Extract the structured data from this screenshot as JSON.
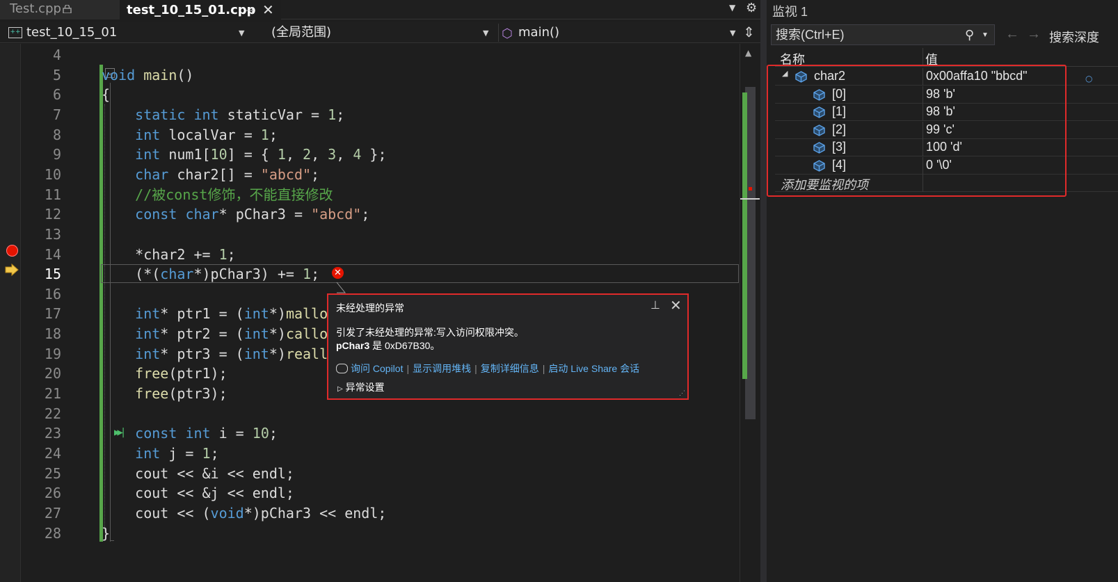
{
  "tabs": [
    {
      "label": "Test.cpp",
      "locked": true,
      "active": false
    },
    {
      "label": "test_10_15_01.cpp",
      "active": true
    }
  ],
  "navbar": {
    "project": "test_10_15_01",
    "scope": "(全局范围)",
    "function": "main()"
  },
  "code": {
    "current_line": 15,
    "breakpoint_line": 14,
    "lines": [
      {
        "n": "4",
        "html": ""
      },
      {
        "n": "5",
        "html": "<span class=\"kw\">void</span> <span class=\"fn\">main</span>()"
      },
      {
        "n": "6",
        "html": "{"
      },
      {
        "n": "7",
        "html": "    <span class=\"kw\">static</span> <span class=\"kw\">int</span> staticVar = <span class=\"num\">1</span>;"
      },
      {
        "n": "8",
        "html": "    <span class=\"kw\">int</span> localVar = <span class=\"num\">1</span>;"
      },
      {
        "n": "9",
        "html": "    <span class=\"kw\">int</span> num1[<span class=\"num\">10</span>] = { <span class=\"num\">1</span>, <span class=\"num\">2</span>, <span class=\"num\">3</span>, <span class=\"num\">4</span> };"
      },
      {
        "n": "10",
        "html": "    <span class=\"kw\">char</span> char2[] = <span class=\"str\">\"abcd\"</span>;"
      },
      {
        "n": "11",
        "html": "    <span class=\"cmt\">//被const修饰，不能直接修改</span>"
      },
      {
        "n": "12",
        "html": "    <span class=\"kw\">const</span> <span class=\"kw\">char</span>* pChar3 = <span class=\"str\">\"abcd\"</span>;"
      },
      {
        "n": "13",
        "html": ""
      },
      {
        "n": "14",
        "html": "    *char2 += <span class=\"num\">1</span>;"
      },
      {
        "n": "15",
        "html": "    (*(<span class=\"kw\">char</span>*)pChar3) += <span class=\"num\">1</span>;"
      },
      {
        "n": "16",
        "html": ""
      },
      {
        "n": "17",
        "html": "    <span class=\"kw\">int</span>* ptr1 = (<span class=\"kw\">int</span>*)<span class=\"fn\">mallo</span>"
      },
      {
        "n": "18",
        "html": "    <span class=\"kw\">int</span>* ptr2 = (<span class=\"kw\">int</span>*)<span class=\"fn\">callo</span>"
      },
      {
        "n": "19",
        "html": "    <span class=\"kw\">int</span>* ptr3 = (<span class=\"kw\">int</span>*)<span class=\"fn\">reall</span>"
      },
      {
        "n": "20",
        "html": "    <span class=\"fn\">free</span>(ptr1);"
      },
      {
        "n": "21",
        "html": "    <span class=\"fn\">free</span>(ptr3);"
      },
      {
        "n": "22",
        "html": ""
      },
      {
        "n": "23",
        "html": "    <span class=\"kw\">const</span> <span class=\"kw\">int</span> i = <span class=\"num\">10</span>;"
      },
      {
        "n": "24",
        "html": "    <span class=\"kw\">int</span> j = <span class=\"num\">1</span>;"
      },
      {
        "n": "25",
        "html": "    cout &lt;&lt; &amp;i &lt;&lt; endl;"
      },
      {
        "n": "26",
        "html": "    cout &lt;&lt; &amp;j &lt;&lt; endl;"
      },
      {
        "n": "27",
        "html": "    cout &lt;&lt; (<span class=\"kw\">void</span>*)pChar3 &lt;&lt; endl;"
      },
      {
        "n": "28",
        "html": "}"
      }
    ]
  },
  "exception": {
    "title": "未经处理的异常",
    "message": "引发了未经处理的异常:写入访问权限冲突。",
    "detail_var": "pChar3",
    "detail_rest": " 是 0xD67B30。",
    "links": [
      "询问 Copilot",
      "显示调用堆栈",
      "复制详细信息",
      "启动 Live Share 会话"
    ],
    "settings": "异常设置"
  },
  "watch": {
    "title": "监视 1",
    "search_placeholder": "搜索(Ctrl+E)",
    "search_depth_label": "搜索深度",
    "col_name": "名称",
    "col_value": "值",
    "rows": [
      {
        "name": "char2",
        "value": "0x00affa10 \"bbcd\"",
        "expanded": true
      },
      {
        "name": "[0]",
        "value": "98 'b'"
      },
      {
        "name": "[1]",
        "value": "98 'b'"
      },
      {
        "name": "[2]",
        "value": "99 'c'"
      },
      {
        "name": "[3]",
        "value": "100 'd'"
      },
      {
        "name": "[4]",
        "value": "0 '\\0'"
      }
    ],
    "add_item": "添加要监视的项"
  },
  "colors": {
    "keyword": "#569cd6",
    "string": "#d69d85",
    "comment": "#57a64a",
    "number": "#b5cea8",
    "error_red": "#e02a2a",
    "link": "#64b5f6"
  },
  "icons": [
    "lock-icon",
    "pin-icon",
    "close-icon",
    "gear-icon",
    "cube-icon",
    "split-icon",
    "breakpoint-icon",
    "exec-arrow-icon",
    "error-icon",
    "search-icon",
    "back-icon",
    "forward-icon",
    "object-icon"
  ]
}
